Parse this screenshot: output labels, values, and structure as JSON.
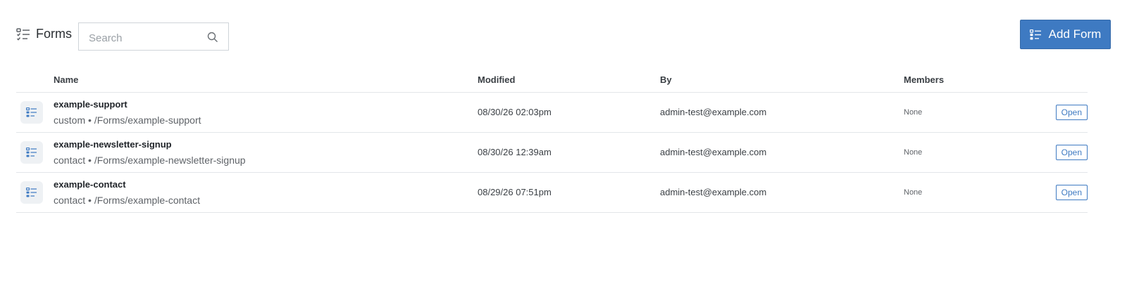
{
  "header": {
    "title": "Forms",
    "search_placeholder": "Search",
    "search_value": "",
    "add_button_label": "Add Form"
  },
  "table": {
    "columns": {
      "name": "Name",
      "modified": "Modified",
      "by": "By",
      "members": "Members"
    },
    "rows": [
      {
        "name": "example-support",
        "subtitle": "custom • /Forms/example-support",
        "modified": "08/30/26 02:03pm",
        "by": "admin-test@example.com",
        "members": "None",
        "action": "Open"
      },
      {
        "name": "example-newsletter-signup",
        "subtitle": "contact • /Forms/example-newsletter-signup",
        "modified": "08/30/26 12:39am",
        "by": "admin-test@example.com",
        "members": "None",
        "action": "Open"
      },
      {
        "name": "example-contact",
        "subtitle": "contact • /Forms/example-contact",
        "modified": "08/29/26 07:51pm",
        "by": "admin-test@example.com",
        "members": "None",
        "action": "Open"
      }
    ]
  },
  "icons": {
    "title": "form-list-icon",
    "search": "search-icon",
    "add": "form-list-icon",
    "row": "form-list-icon"
  },
  "colors": {
    "accent": "#3e7ac2",
    "row_icon_bg": "#eef1f4",
    "divider": "#e3e6e9"
  }
}
